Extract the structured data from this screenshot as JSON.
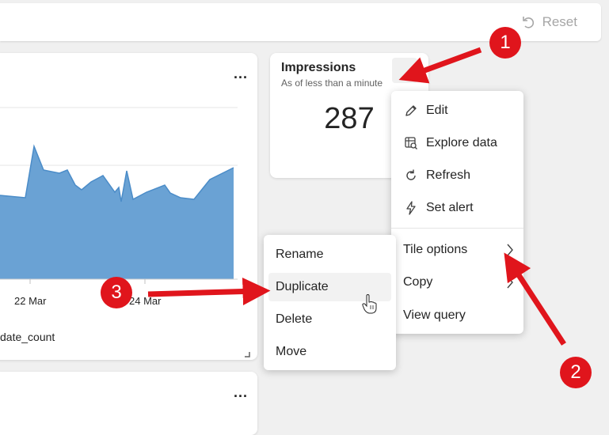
{
  "toolbar": {
    "reset_label": "Reset"
  },
  "chart_card": {
    "x_ticks": [
      "22 Mar",
      "24 Mar"
    ],
    "legend_label": "date_count",
    "more_label": "...",
    "chart_data": {
      "type": "area",
      "x": [
        "22 Mar",
        "24 Mar"
      ],
      "series": [
        {
          "name": "date_count",
          "color": "#6aa2d4"
        }
      ],
      "xlabel": "",
      "ylabel": ""
    }
  },
  "bottom_card": {
    "more_label": "..."
  },
  "impressions_tile": {
    "title": "Impressions",
    "subtitle": "As of less than a minute",
    "value": "287"
  },
  "context_menu": {
    "items": [
      {
        "label": "Edit",
        "icon": "pencil-icon"
      },
      {
        "label": "Explore data",
        "icon": "explore-data-icon"
      },
      {
        "label": "Refresh",
        "icon": "refresh-icon"
      },
      {
        "label": "Set alert",
        "icon": "alert-icon"
      },
      {
        "label": "Tile options",
        "icon": "chevron-right-icon"
      },
      {
        "label": "Copy",
        "icon": "chevron-right-icon"
      },
      {
        "label": "View query"
      }
    ]
  },
  "tile_options_submenu": {
    "items": [
      {
        "label": "Rename"
      },
      {
        "label": "Duplicate"
      },
      {
        "label": "Delete"
      },
      {
        "label": "Move"
      }
    ]
  },
  "annotations": {
    "badges": [
      "1",
      "2",
      "3"
    ],
    "color": "#e0151c"
  }
}
